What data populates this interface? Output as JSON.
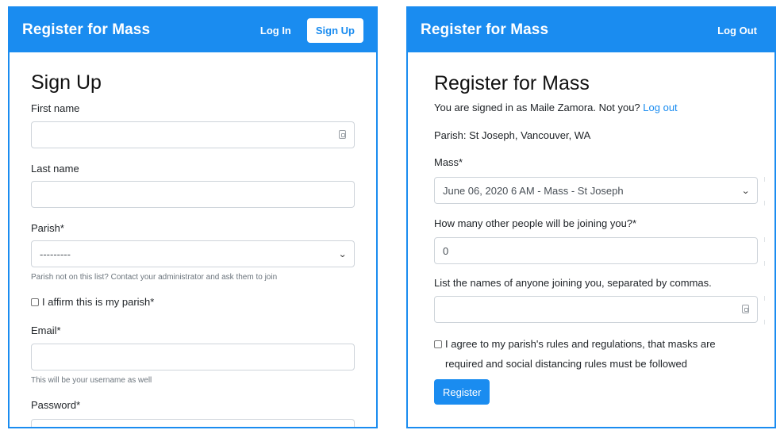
{
  "left": {
    "navbar": {
      "brand": "Register for Mass",
      "login": "Log In",
      "signup": "Sign Up"
    },
    "title": "Sign Up",
    "fields": {
      "first_name_label": "First name",
      "first_name_value": "",
      "last_name_label": "Last name",
      "last_name_value": "",
      "parish_label": "Parish*",
      "parish_selected": "---------",
      "parish_help": "Parish not on this list? Contact your administrator and ask them to join",
      "affirm_label": "I affirm this is my parish*",
      "email_label": "Email*",
      "email_value": "",
      "email_help": "This will be your username as well",
      "password_label": "Password*"
    }
  },
  "right": {
    "navbar": {
      "brand": "Register for Mass",
      "logout": "Log Out"
    },
    "title": "Register for Mass",
    "signed_in_prefix": "You are signed in as Maile Zamora. Not you?",
    "signed_in_link": "Log out",
    "parish": "Parish: St Joseph, Vancouver, WA",
    "mass_label": "Mass*",
    "mass_selected": "June 06, 2020 6 AM - Mass - St Joseph",
    "others_label": "How many other people will be joining you?*",
    "others_value": "0",
    "names_label": "List the names of anyone joining you, separated by commas.",
    "names_value": "",
    "agree_line1": "I agree to my parish's rules and regulations, that masks are",
    "agree_line2": "required and social distancing rules must be followed",
    "register_button": "Register"
  },
  "colors": {
    "accent": "#1a8cf0",
    "border": "#ced4da",
    "muted": "#6c757d"
  },
  "icons": {
    "key": "key-icon",
    "dropdown": "chevron-down-icon",
    "checkbox": "checkbox-icon"
  }
}
